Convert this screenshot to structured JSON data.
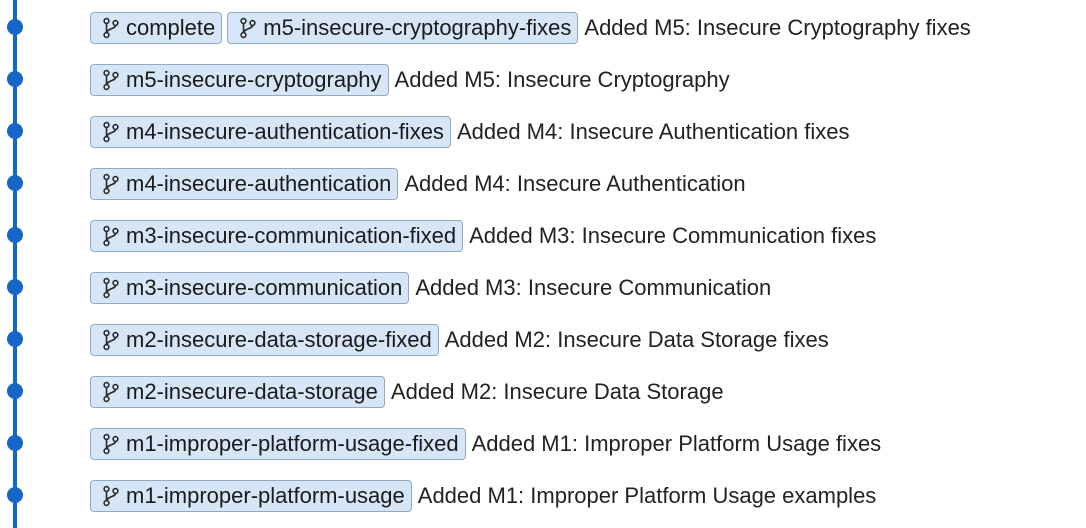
{
  "graph": {
    "line_color": "#1566c8",
    "badge_bg": "#d6e6f7",
    "badge_border": "#93a9c2"
  },
  "commits": [
    {
      "refs": [
        {
          "name": "complete",
          "icon": "branch-icon"
        },
        {
          "name": "m5-insecure-cryptography-fixes",
          "icon": "branch-icon"
        }
      ],
      "message": "Added M5: Insecure Cryptography fixes"
    },
    {
      "refs": [
        {
          "name": "m5-insecure-cryptography",
          "icon": "branch-icon"
        }
      ],
      "message": "Added M5: Insecure Cryptography"
    },
    {
      "refs": [
        {
          "name": "m4-insecure-authentication-fixes",
          "icon": "branch-icon"
        }
      ],
      "message": "Added M4: Insecure Authentication fixes"
    },
    {
      "refs": [
        {
          "name": "m4-insecure-authentication",
          "icon": "branch-icon"
        }
      ],
      "message": "Added M4: Insecure Authentication"
    },
    {
      "refs": [
        {
          "name": "m3-insecure-communication-fixed",
          "icon": "branch-icon"
        }
      ],
      "message": "Added M3: Insecure Communication fixes"
    },
    {
      "refs": [
        {
          "name": "m3-insecure-communication",
          "icon": "branch-icon"
        }
      ],
      "message": "Added M3: Insecure Communication"
    },
    {
      "refs": [
        {
          "name": "m2-insecure-data-storage-fixed",
          "icon": "branch-icon"
        }
      ],
      "message": "Added M2: Insecure Data Storage fixes"
    },
    {
      "refs": [
        {
          "name": "m2-insecure-data-storage",
          "icon": "branch-icon"
        }
      ],
      "message": "Added M2: Insecure Data Storage"
    },
    {
      "refs": [
        {
          "name": "m1-improper-platform-usage-fixed",
          "icon": "branch-icon"
        }
      ],
      "message": "Added M1: Improper Platform Usage fixes"
    },
    {
      "refs": [
        {
          "name": "m1-improper-platform-usage",
          "icon": "branch-icon"
        }
      ],
      "message": "Added M1: Improper Platform Usage examples"
    }
  ]
}
